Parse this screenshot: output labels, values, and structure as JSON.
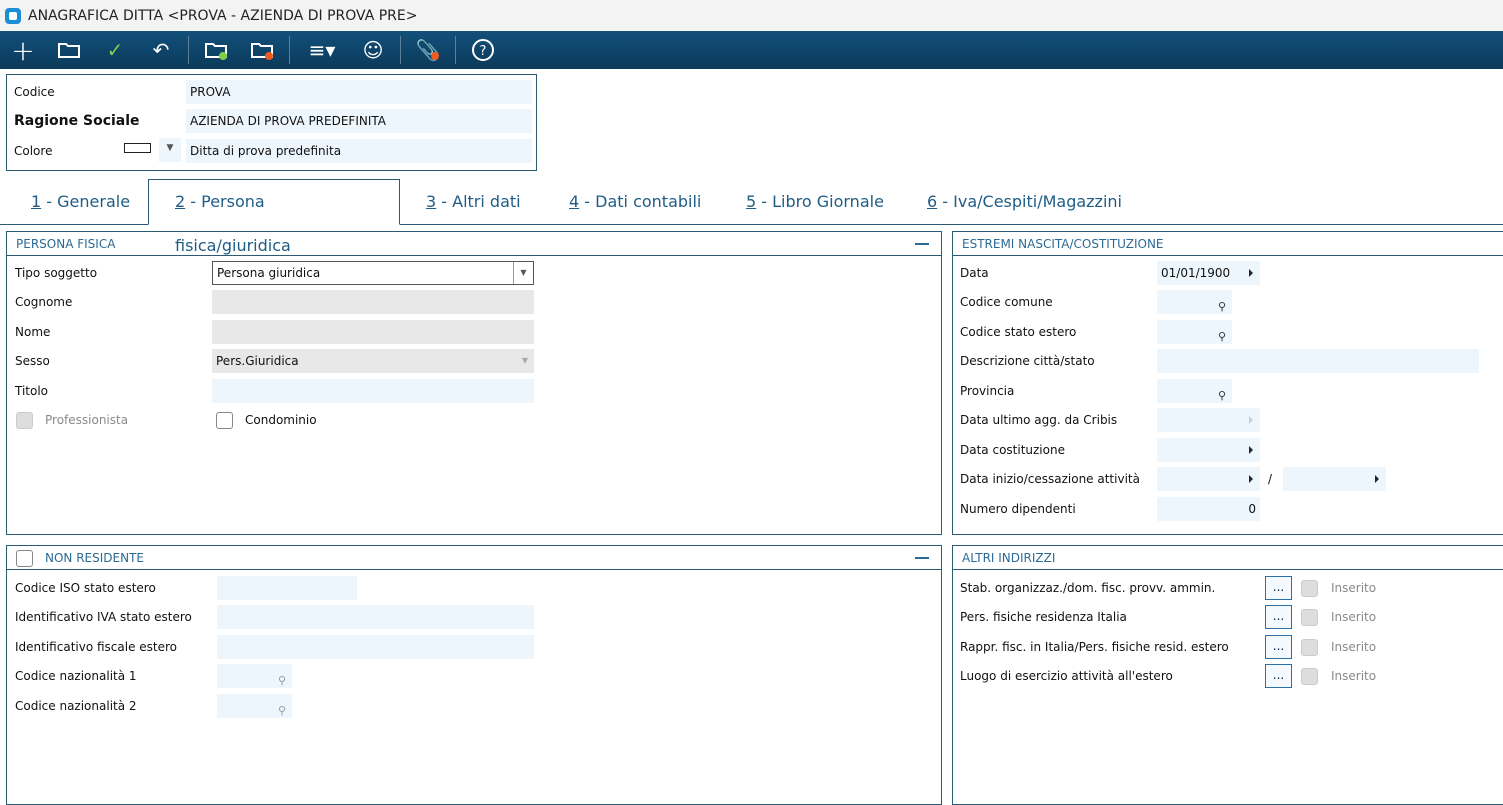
{
  "window": {
    "title": "ANAGRAFICA DITTA <PROVA - AZIENDA DI PROVA PRE>"
  },
  "toolbar": {
    "items": [
      "new",
      "open",
      "confirm",
      "undo",
      "folder-green",
      "folder-orange",
      "menu",
      "contacts",
      "attach",
      "help"
    ]
  },
  "header": {
    "codice_label": "Codice",
    "codice": "PROVA",
    "ragione_label": "Ragione Sociale",
    "ragione": "AZIENDA DI PROVA PREDEFINITA",
    "colore_label": "Colore",
    "colore_desc": "Ditta di prova predefinita"
  },
  "tabs": [
    {
      "num": "1",
      "label": " - Generale"
    },
    {
      "num": "2",
      "label": " - Persona fisica/giuridica"
    },
    {
      "num": "3",
      "label": " - Altri dati"
    },
    {
      "num": "4",
      "label": " - Dati contabili"
    },
    {
      "num": "5",
      "label": " - Libro Giornale"
    },
    {
      "num": "6",
      "label": " - Iva/Cespiti/Magazzini"
    }
  ],
  "persona": {
    "title": "PERSONA FISICA",
    "tipo_label": "Tipo soggetto",
    "tipo": "Persona giuridica",
    "cognome_label": "Cognome",
    "nome_label": "Nome",
    "sesso_label": "Sesso",
    "sesso": "Pers.Giuridica",
    "titolo_label": "Titolo",
    "professionista": "Professionista",
    "condominio": "Condominio"
  },
  "estremi": {
    "title": "ESTREMI NASCITA/COSTITUZIONE",
    "data_label": "Data",
    "data": "01/01/1900",
    "comune_label": "Codice comune",
    "stato_label": "Codice stato estero",
    "desc_label": "Descrizione città/stato",
    "prov_label": "Provincia",
    "cribis_label": "Data ultimo agg. da Cribis",
    "cost_label": "Data costituzione",
    "inizio_label": "Data inizio/cessazione attività",
    "slash": "/",
    "dip_label": "Numero dipendenti",
    "dip": "0"
  },
  "nonres": {
    "title": "NON RESIDENTE",
    "iso_label": "Codice ISO stato estero",
    "iva_label": "Identificativo IVA stato estero",
    "fisc_label": "Identificativo fiscale estero",
    "naz1_label": "Codice nazionalità 1",
    "naz2_label": "Codice nazionalità 2"
  },
  "altri": {
    "title": "ALTRI INDIRIZZI",
    "btn": "...",
    "inserito": "Inserito",
    "rows": [
      "Stab. organizzaz./dom. fisc. provv. ammin.",
      "Pers. fisiche residenza Italia",
      "Rappr. fisc. in Italia/Pers. fisiche resid. estero",
      "Luogo di esercizio attività all'estero"
    ]
  }
}
